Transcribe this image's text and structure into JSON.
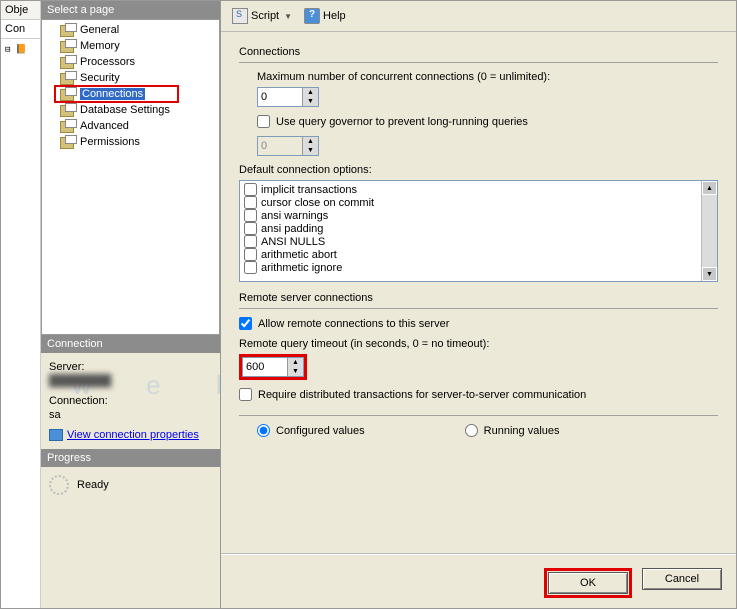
{
  "leftStrip": {
    "obje": "Obje",
    "conn": "Con"
  },
  "sidebar": {
    "header": "Select a page",
    "items": [
      {
        "label": "General"
      },
      {
        "label": "Memory"
      },
      {
        "label": "Processors"
      },
      {
        "label": "Security"
      },
      {
        "label": "Connections"
      },
      {
        "label": "Database Settings"
      },
      {
        "label": "Advanced"
      },
      {
        "label": "Permissions"
      }
    ],
    "connection_header": "Connection",
    "server_label": "Server:",
    "connection_label": "Connection:",
    "connection_value": "sa",
    "view_props": "View connection properties",
    "progress_header": "Progress",
    "progress_status": "Ready"
  },
  "toolbar": {
    "script": "Script",
    "help": "Help"
  },
  "main": {
    "connections_group": "Connections",
    "max_conn_label": "Maximum number of concurrent connections (0 = unlimited):",
    "max_conn_value": "0",
    "governor_label": "Use query governor to prevent long-running queries",
    "governor_value": "0",
    "default_options_label": "Default connection options:",
    "options": [
      "implicit transactions",
      "cursor close on commit",
      "ansi warnings",
      "ansi padding",
      "ANSI NULLS",
      "arithmetic abort",
      "arithmetic ignore"
    ],
    "remote_group": "Remote server connections",
    "allow_remote": "Allow remote connections to this server",
    "remote_timeout_label": "Remote query timeout (in seconds, 0 = no timeout):",
    "remote_timeout_value": "600",
    "require_dt": "Require distributed transactions for server-to-server communication",
    "configured": "Configured values",
    "running": "Running values"
  },
  "buttons": {
    "ok": "OK",
    "cancel": "Cancel"
  }
}
